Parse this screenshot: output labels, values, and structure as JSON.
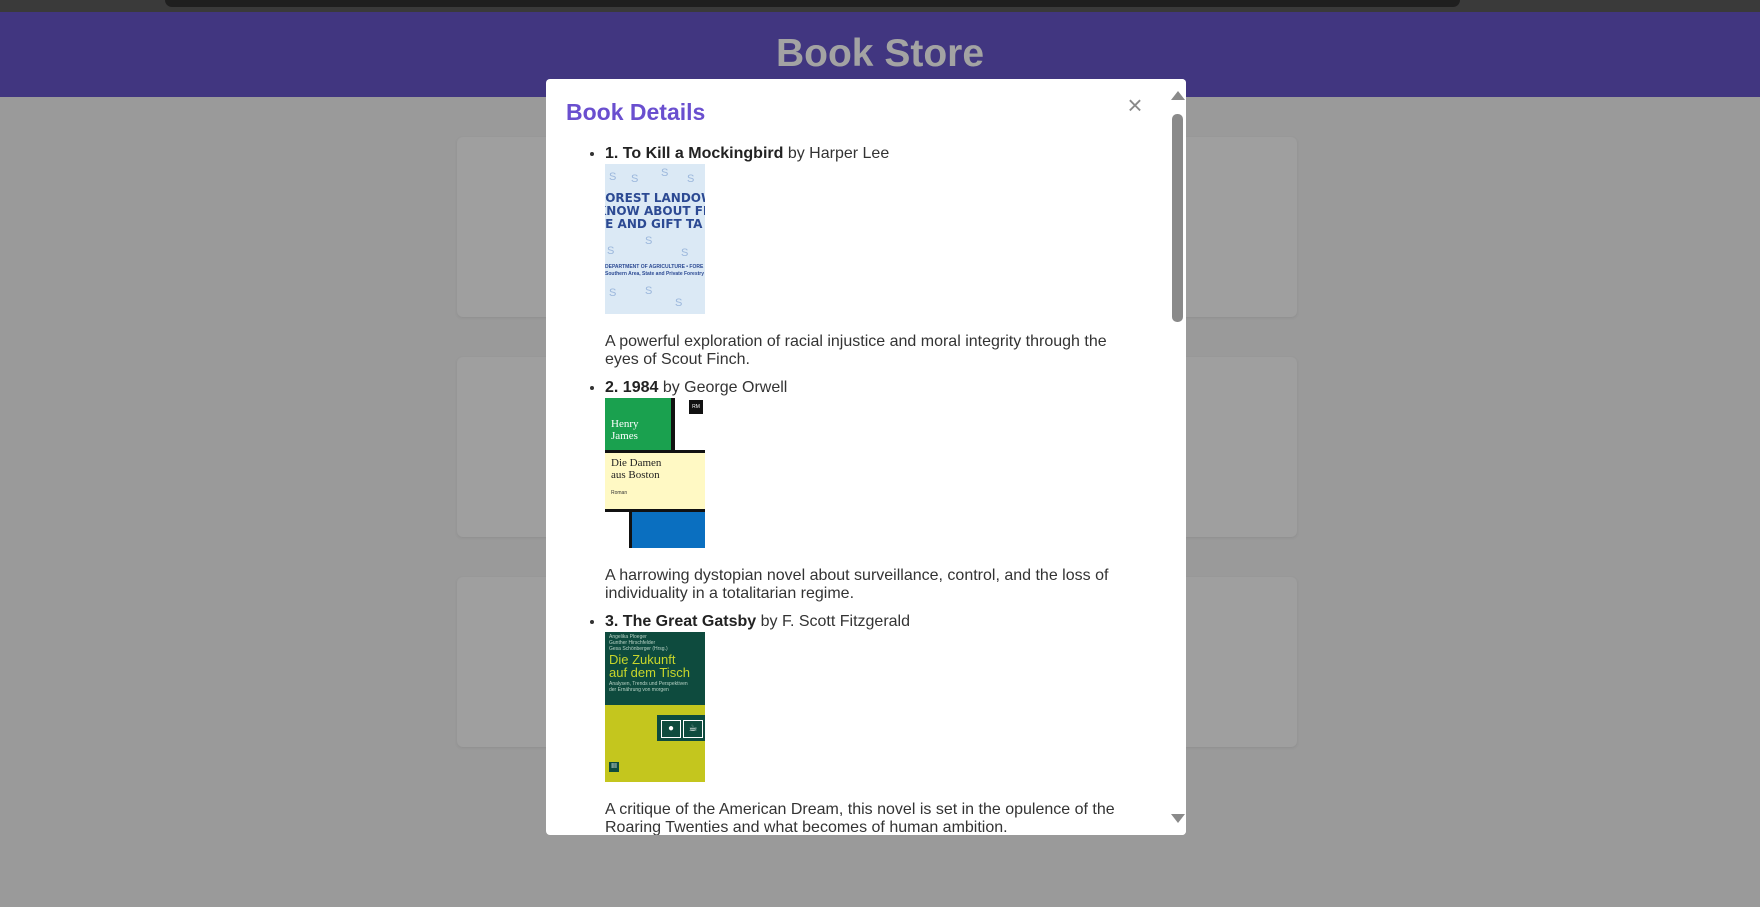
{
  "header": {
    "title": "Book Store"
  },
  "modal": {
    "title": "Book Details",
    "close_label": "×",
    "books": [
      {
        "number": "1. To Kill a Mockingbird",
        "by": " by Harper Lee",
        "description": "A powerful exploration of racial injustice and moral integrity through the eyes of Scout Finch.",
        "cover": {
          "title": "FOREST LANDOWNERS KNOW ABOUT FEDERAL ESTATE AND GIFT TAXES",
          "line1": "FOREST LANDOW",
          "line2": "KNOW ABOUT FE",
          "line3": "TE AND GIFT TA",
          "footer1": "DEPARTMENT OF AGRICULTURE • FORE",
          "footer2": "Southern Area, State and Private Forestry"
        }
      },
      {
        "number": "2. 1984",
        "by": " by George Orwell",
        "description": "A harrowing dystopian novel about surveillance, control, and the loss of individuality in a totalitarian regime.",
        "cover": {
          "author1": "Henry",
          "author2": "James",
          "title1": "Die Damen",
          "title2": "aus Boston",
          "sub": "Roman",
          "logo": "RM"
        }
      },
      {
        "number": "3. The Great Gatsby",
        "by": " by F. Scott Fitzgerald",
        "description": "A critique of the American Dream, this novel is set in the opulence of the Roaring Twenties and what becomes of human ambition.",
        "cover": {
          "eds1": "Angelika Ploeger",
          "eds2": "Gunther Hirschfelder",
          "eds3": "Gesa Schönberger (Hrsg.)",
          "title1": "Die Zukunft",
          "title2": "auf dem Tisch",
          "sub1": "Analysen, Trends und Perspektiven",
          "sub2": "der Ernährung von morgen",
          "pub": "III"
        }
      }
    ]
  },
  "colors": {
    "header_bg": "#413680",
    "modal_title": "#6a4fcf",
    "overlay": "#9a9a9a"
  }
}
